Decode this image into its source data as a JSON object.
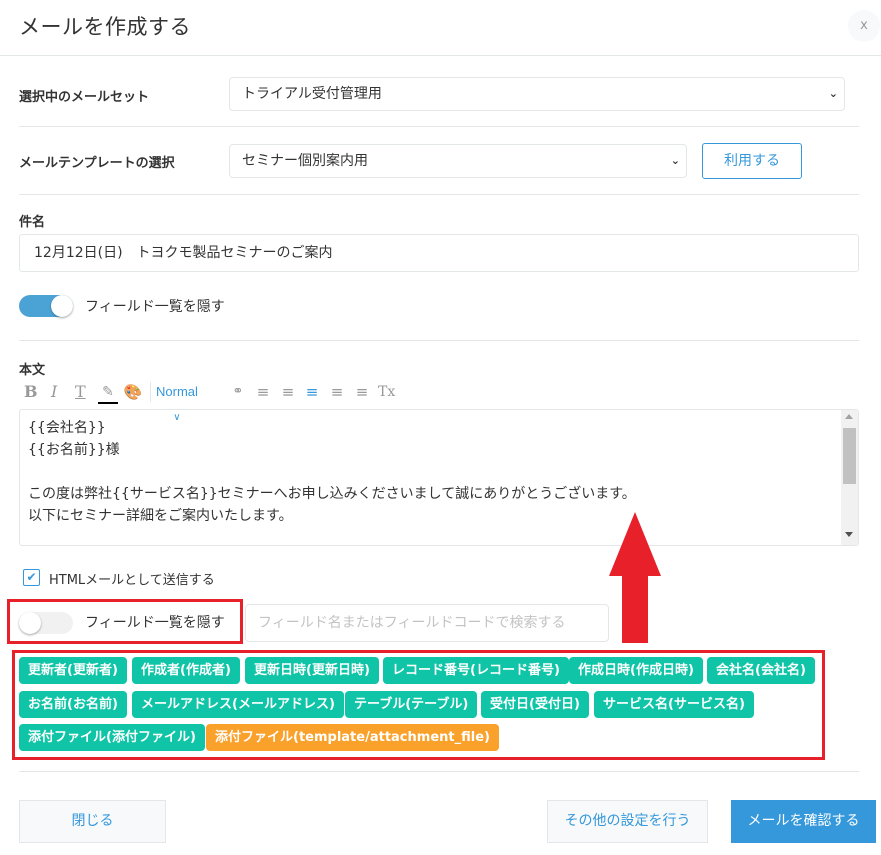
{
  "dialog": {
    "title": "メールを作成する",
    "close_label": "x"
  },
  "mail_set": {
    "label": "選択中のメールセット",
    "selected": "トライアル受付管理用"
  },
  "template": {
    "label": "メールテンプレートの選択",
    "selected": "セミナー個別案内用",
    "use_button": "利用する"
  },
  "subject": {
    "label": "件名",
    "value": "12月12日(日)　トヨクモ製品セミナーのご案内"
  },
  "top_field_toggle": {
    "label": "フィールド一覧を隠す",
    "state": "on"
  },
  "body": {
    "label": "本文",
    "toolbar": {
      "bold": "B",
      "italic": "I",
      "underline": "T",
      "font_size": "Normal",
      "clear_format": "Tx"
    },
    "content": "{{会社名}}\n{{お名前}}様\n\nこの度は弊社{{サービス名}}セミナーへお申し込みくださいまして誠にありがとうございます。\n以下にセミナー詳細をご案内いたします。"
  },
  "html_mail": {
    "label": "HTMLメールとして送信する",
    "checked": true
  },
  "bottom_field_toggle": {
    "label": "フィールド一覧を隠す",
    "state": "off"
  },
  "field_search": {
    "placeholder": "フィールド名またはフィールドコードで検索する"
  },
  "fields": [
    {
      "label": "更新者(更新者)",
      "type": "field"
    },
    {
      "label": "作成者(作成者)",
      "type": "field"
    },
    {
      "label": "更新日時(更新日時)",
      "type": "field"
    },
    {
      "label": "レコード番号(レコード番号)",
      "type": "field"
    },
    {
      "label": "作成日時(作成日時)",
      "type": "field"
    },
    {
      "label": "会社名(会社名)",
      "type": "field"
    },
    {
      "label": "お名前(お名前)",
      "type": "field"
    },
    {
      "label": "メールアドレス(メールアドレス)",
      "type": "field"
    },
    {
      "label": "テーブル(テーブル)",
      "type": "field"
    },
    {
      "label": "受付日(受付日)",
      "type": "field"
    },
    {
      "label": "サービス名(サービス名)",
      "type": "field"
    },
    {
      "label": "添付ファイル(添付ファイル)",
      "type": "field"
    },
    {
      "label": "添付ファイル(template/attachment_file)",
      "type": "template"
    }
  ],
  "footer": {
    "close_button": "閉じる",
    "other_settings_button": "その他の設定を行う",
    "confirm_button": "メールを確認する"
  },
  "colors": {
    "accent": "#3498db",
    "chip_field": "#10c5a7",
    "chip_template": "#f9a12b",
    "annotation": "#e8202a"
  }
}
